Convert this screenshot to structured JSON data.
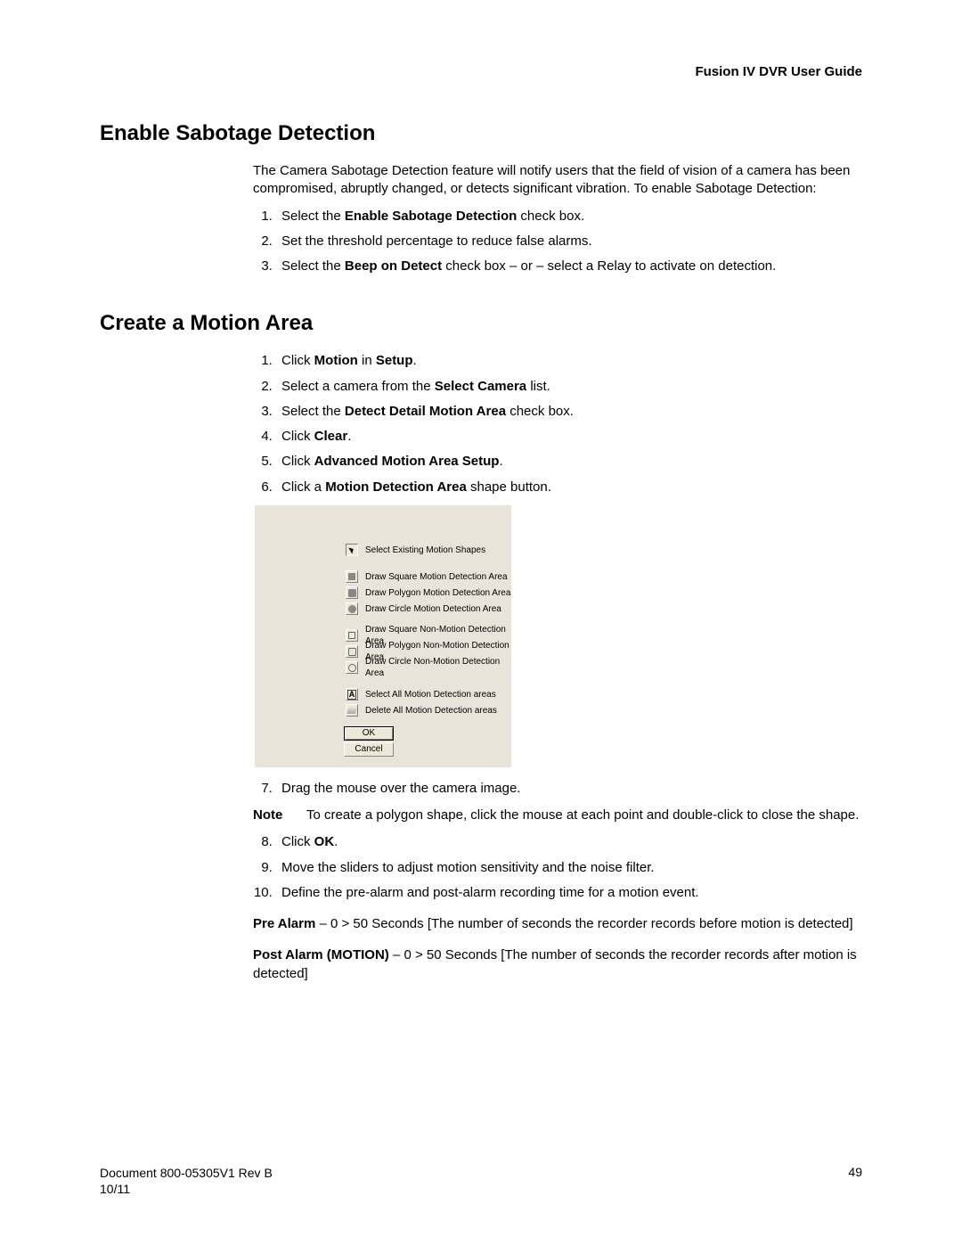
{
  "header": {
    "guide_title": "Fusion IV DVR User Guide"
  },
  "section1": {
    "heading": "Enable Sabotage Detection",
    "intro": "The Camera Sabotage Detection feature will notify users that the field of vision of a camera has been compromised, abruptly changed, or detects significant vibration. To enable Sabotage Detection:",
    "steps": {
      "s1_a": "Select the ",
      "s1_b": "Enable Sabotage Detection",
      "s1_c": " check box.",
      "s2": "Set the threshold percentage to reduce false alarms.",
      "s3_a": "Select the ",
      "s3_b": "Beep on Detect",
      "s3_c": " check box – or – select a Relay to activate on detection."
    }
  },
  "section2": {
    "heading": "Create a Motion Area",
    "steps_a": {
      "s1_a": "Click ",
      "s1_b": "Motion",
      "s1_c": " in ",
      "s1_d": "Setup",
      "s1_e": ".",
      "s2_a": "Select a camera from the ",
      "s2_b": "Select Camera",
      "s2_c": " list.",
      "s3_a": "Select the ",
      "s3_b": "Detect Detail Motion Area",
      "s3_c": " check box.",
      "s4_a": "Click ",
      "s4_b": "Clear",
      "s4_c": ".",
      "s5_a": "Click ",
      "s5_b": "Advanced Motion Area Setup",
      "s5_c": ".",
      "s6_a": "Click a ",
      "s6_b": "Motion Detection Area",
      "s6_c": " shape button."
    },
    "dialog": {
      "r1": "Select Existing Motion Shapes",
      "r2": "Draw Square Motion Detection Area",
      "r3": "Draw Polygon Motion Detection Area",
      "r4": "Draw Circle  Motion Detection Area",
      "r5": "Draw Square Non-Motion Detection Area",
      "r6": "Draw Polygon Non-Motion Detection Area",
      "r7": "Draw Circle  Non-Motion Detection Area",
      "r8": "Select All Motion Detection areas",
      "r9": "Delete  All Motion Detection areas",
      "ok": "OK",
      "cancel": "Cancel"
    },
    "steps_b": {
      "s7": "Drag the mouse over the camera image."
    },
    "note": {
      "label": "Note",
      "text": "To create a polygon shape, click the mouse at each point and double-click to close the shape."
    },
    "steps_c": {
      "s8_a": "Click ",
      "s8_b": "OK",
      "s8_c": ".",
      "s9": "Move the sliders to adjust motion sensitivity and the noise filter.",
      "s10": "Define the pre-alarm and post-alarm recording time for a motion event."
    },
    "pre_alarm": {
      "label": "Pre Alarm",
      "text": " – 0 > 50 Seconds [The number of seconds the recorder records before motion is detected]"
    },
    "post_alarm": {
      "label": "Post Alarm (MOTION)",
      "text": " – 0 > 50 Seconds [The number of seconds the recorder records after motion is detected]"
    }
  },
  "footer": {
    "doc": "Document 800-05305V1 Rev B",
    "date": "10/11",
    "page": "49"
  }
}
